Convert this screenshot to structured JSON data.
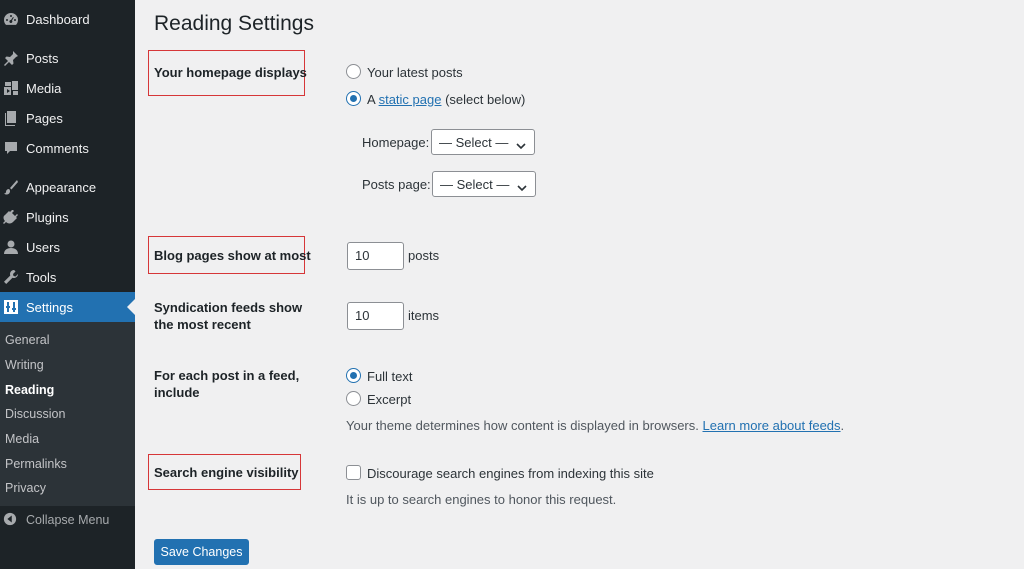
{
  "sidebar": {
    "items": [
      {
        "label": "Dashboard",
        "icon": "dashboard-icon"
      },
      {
        "label": "Posts",
        "icon": "pin-icon"
      },
      {
        "label": "Media",
        "icon": "media-icon"
      },
      {
        "label": "Pages",
        "icon": "pages-icon"
      },
      {
        "label": "Comments",
        "icon": "comment-icon"
      },
      {
        "label": "Appearance",
        "icon": "brush-icon"
      },
      {
        "label": "Plugins",
        "icon": "plug-icon"
      },
      {
        "label": "Users",
        "icon": "user-icon"
      },
      {
        "label": "Tools",
        "icon": "wrench-icon"
      },
      {
        "label": "Settings",
        "icon": "settings-icon"
      }
    ],
    "submenu": [
      "General",
      "Writing",
      "Reading",
      "Discussion",
      "Media",
      "Permalinks",
      "Privacy"
    ],
    "current_submenu": "Reading",
    "collapse_label": "Collapse Menu"
  },
  "page": {
    "title": "Reading Settings"
  },
  "homepage": {
    "label": "Your homepage displays",
    "option_latest": "Your latest posts",
    "option_static_prefix": "A",
    "option_static_link": "static page",
    "option_static_suffix": "(select below)",
    "selected": "static",
    "homepage_label": "Homepage:",
    "homepage_value": "— Select —",
    "posts_page_label": "Posts page:",
    "posts_page_value": "— Select —"
  },
  "blog_pages": {
    "label": "Blog pages show at most",
    "value": "10",
    "unit": "posts"
  },
  "syndication": {
    "label": "Syndication feeds show the most recent",
    "value": "10",
    "unit": "items"
  },
  "feed_content": {
    "label": "For each post in a feed, include",
    "option_full": "Full text",
    "option_excerpt": "Excerpt",
    "selected": "full",
    "description": "Your theme determines how content is displayed in browsers.",
    "learn_more": "Learn more about feeds",
    "period": "."
  },
  "search_visibility": {
    "label": "Search engine visibility",
    "checkbox_label": "Discourage search engines from indexing this site",
    "checked": false,
    "description": "It is up to search engines to honor this request."
  },
  "save_label": "Save Changes",
  "colors": {
    "accent": "#2271b1",
    "sidebar_bg": "#1d2327",
    "highlight": "#d63638"
  }
}
